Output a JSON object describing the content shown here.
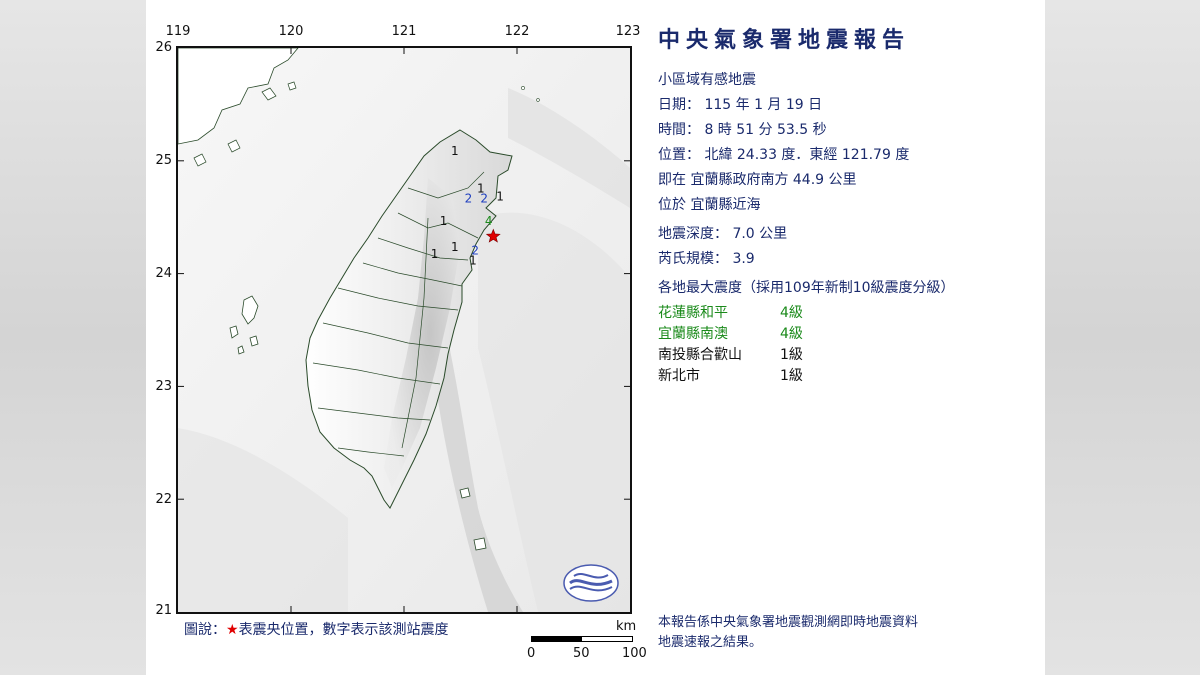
{
  "report": {
    "title": "中央氣象署地震報告",
    "category": "小區域有感地震",
    "date_label": "日期：",
    "date_value": "115 年 1 月 19 日",
    "time_label": "時間：",
    "time_value": "8 時 51 分 53.5 秒",
    "location_label": "位置：",
    "location_value": "北緯 24.33 度．東經 121.79 度",
    "relative_line": "即在 宜蘭縣政府南方 44.9 公里",
    "region_line": "位於 宜蘭縣近海",
    "depth_label": "地震深度：",
    "depth_value": "7.0 公里",
    "magnitude_label": "芮氏規模：",
    "magnitude_value": "3.9",
    "intensity_header": "各地最大震度（採用109年新制10級震度分級）",
    "intensities": [
      {
        "location": "花蓮縣和平",
        "level": "4級",
        "color": "#1a8a1a"
      },
      {
        "location": "宜蘭縣南澳",
        "level": "4級",
        "color": "#1a8a1a"
      },
      {
        "location": "南投縣合歡山",
        "level": "1級",
        "color": "#111111"
      },
      {
        "location": "新北市",
        "level": "1級",
        "color": "#111111"
      }
    ],
    "footnote_line1": "本報告係中央氣象署地震觀測網即時地震資料",
    "footnote_line2": "地震速報之結果。"
  },
  "map": {
    "lon_ticks": [
      "119",
      "120",
      "121",
      "122",
      "123"
    ],
    "lat_ticks": [
      "26",
      "25",
      "24",
      "23",
      "22",
      "21"
    ],
    "epicenter": {
      "lat": 24.33,
      "lon": 121.79,
      "color": "#e00000"
    },
    "stations": [
      {
        "value": "1",
        "lat": 25.05,
        "lon": 121.45,
        "color": "#111111"
      },
      {
        "value": "1",
        "lat": 24.72,
        "lon": 121.68,
        "color": "#111111"
      },
      {
        "value": "1",
        "lat": 24.65,
        "lon": 121.85,
        "color": "#111111"
      },
      {
        "value": "2",
        "lat": 24.63,
        "lon": 121.57,
        "color": "#1f3fbf"
      },
      {
        "value": "2",
        "lat": 24.63,
        "lon": 121.71,
        "color": "#1f3fbf"
      },
      {
        "value": "4",
        "lat": 24.43,
        "lon": 121.75,
        "color": "#1a8a1a"
      },
      {
        "value": "1",
        "lat": 24.43,
        "lon": 121.35,
        "color": "#111111"
      },
      {
        "value": "1",
        "lat": 24.2,
        "lon": 121.45,
        "color": "#111111"
      },
      {
        "value": "2",
        "lat": 24.17,
        "lon": 121.63,
        "color": "#1f3fbf"
      },
      {
        "value": "1",
        "lat": 24.14,
        "lon": 121.27,
        "color": "#111111"
      },
      {
        "value": "1",
        "lat": 24.08,
        "lon": 121.61,
        "color": "#111111"
      }
    ],
    "legend_label": "圖說：",
    "legend_star": "★",
    "legend_text": "表震央位置，數字表示該測站震度",
    "scale_unit": "km",
    "scale_ticks": [
      "0",
      "50",
      "100"
    ]
  }
}
